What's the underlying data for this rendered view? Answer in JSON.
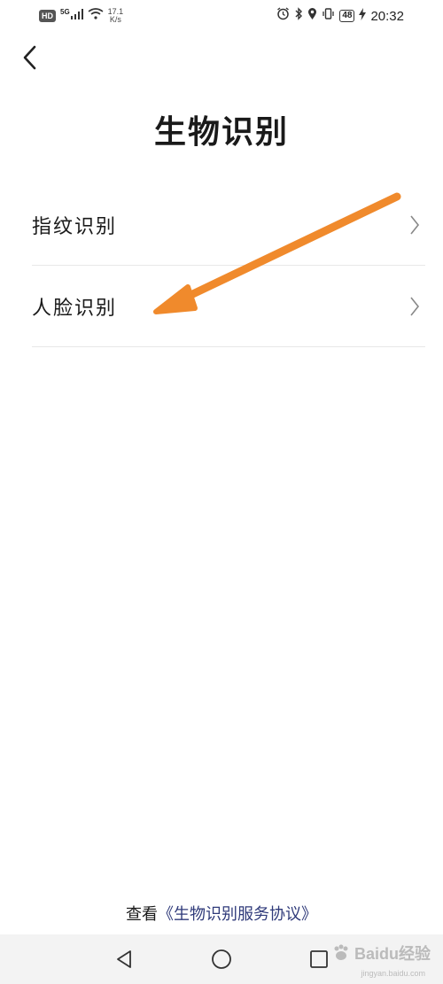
{
  "status_bar": {
    "hd": "HD",
    "network": "5G",
    "speed_value": "17.1",
    "speed_unit": "K/s",
    "battery": "48",
    "time": "20:32"
  },
  "header": {
    "title": "生物识别"
  },
  "menu": {
    "items": [
      {
        "label": "指纹识别"
      },
      {
        "label": "人脸识别"
      }
    ]
  },
  "footer": {
    "prefix": "查看",
    "agreement_link": "《生物识别服务协议》"
  },
  "watermark": {
    "brand": "Baidu经验",
    "domain": "jingyan.baidu.com"
  },
  "colors": {
    "annotation_arrow": "#f08a2c",
    "link": "#2f3a7a"
  }
}
